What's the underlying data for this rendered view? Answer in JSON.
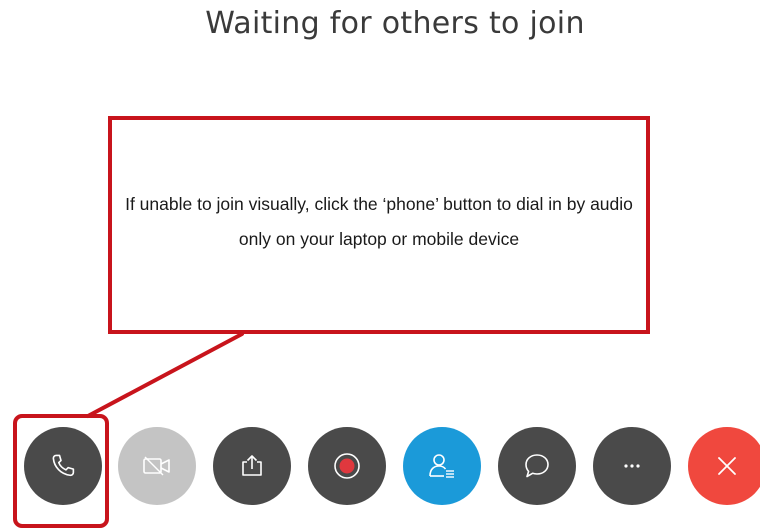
{
  "meeting": {
    "status_title": "Waiting for others to join"
  },
  "callout": {
    "text": "If unable to join visually, click the ‘phone’ button to dial in by audio only on your laptop or mobile device",
    "border_color": "#c8141c"
  },
  "controls": [
    {
      "name": "phone",
      "icon": "phone-icon",
      "color": "#4a4a4a",
      "state": "highlighted"
    },
    {
      "name": "video",
      "icon": "video-camera-icon",
      "color": "#c4c4c4",
      "state": "disabled"
    },
    {
      "name": "share",
      "icon": "share-screen-icon",
      "color": "#4a4a4a"
    },
    {
      "name": "record",
      "icon": "record-icon",
      "color": "#4a4a4a",
      "accent": "#e0383e"
    },
    {
      "name": "participants",
      "icon": "participants-icon",
      "color": "#1b9ad9"
    },
    {
      "name": "chat",
      "icon": "chat-bubble-icon",
      "color": "#4a4a4a"
    },
    {
      "name": "more",
      "icon": "more-options-icon",
      "color": "#4a4a4a"
    },
    {
      "name": "leave",
      "icon": "close-icon",
      "color": "#f0483e"
    }
  ]
}
